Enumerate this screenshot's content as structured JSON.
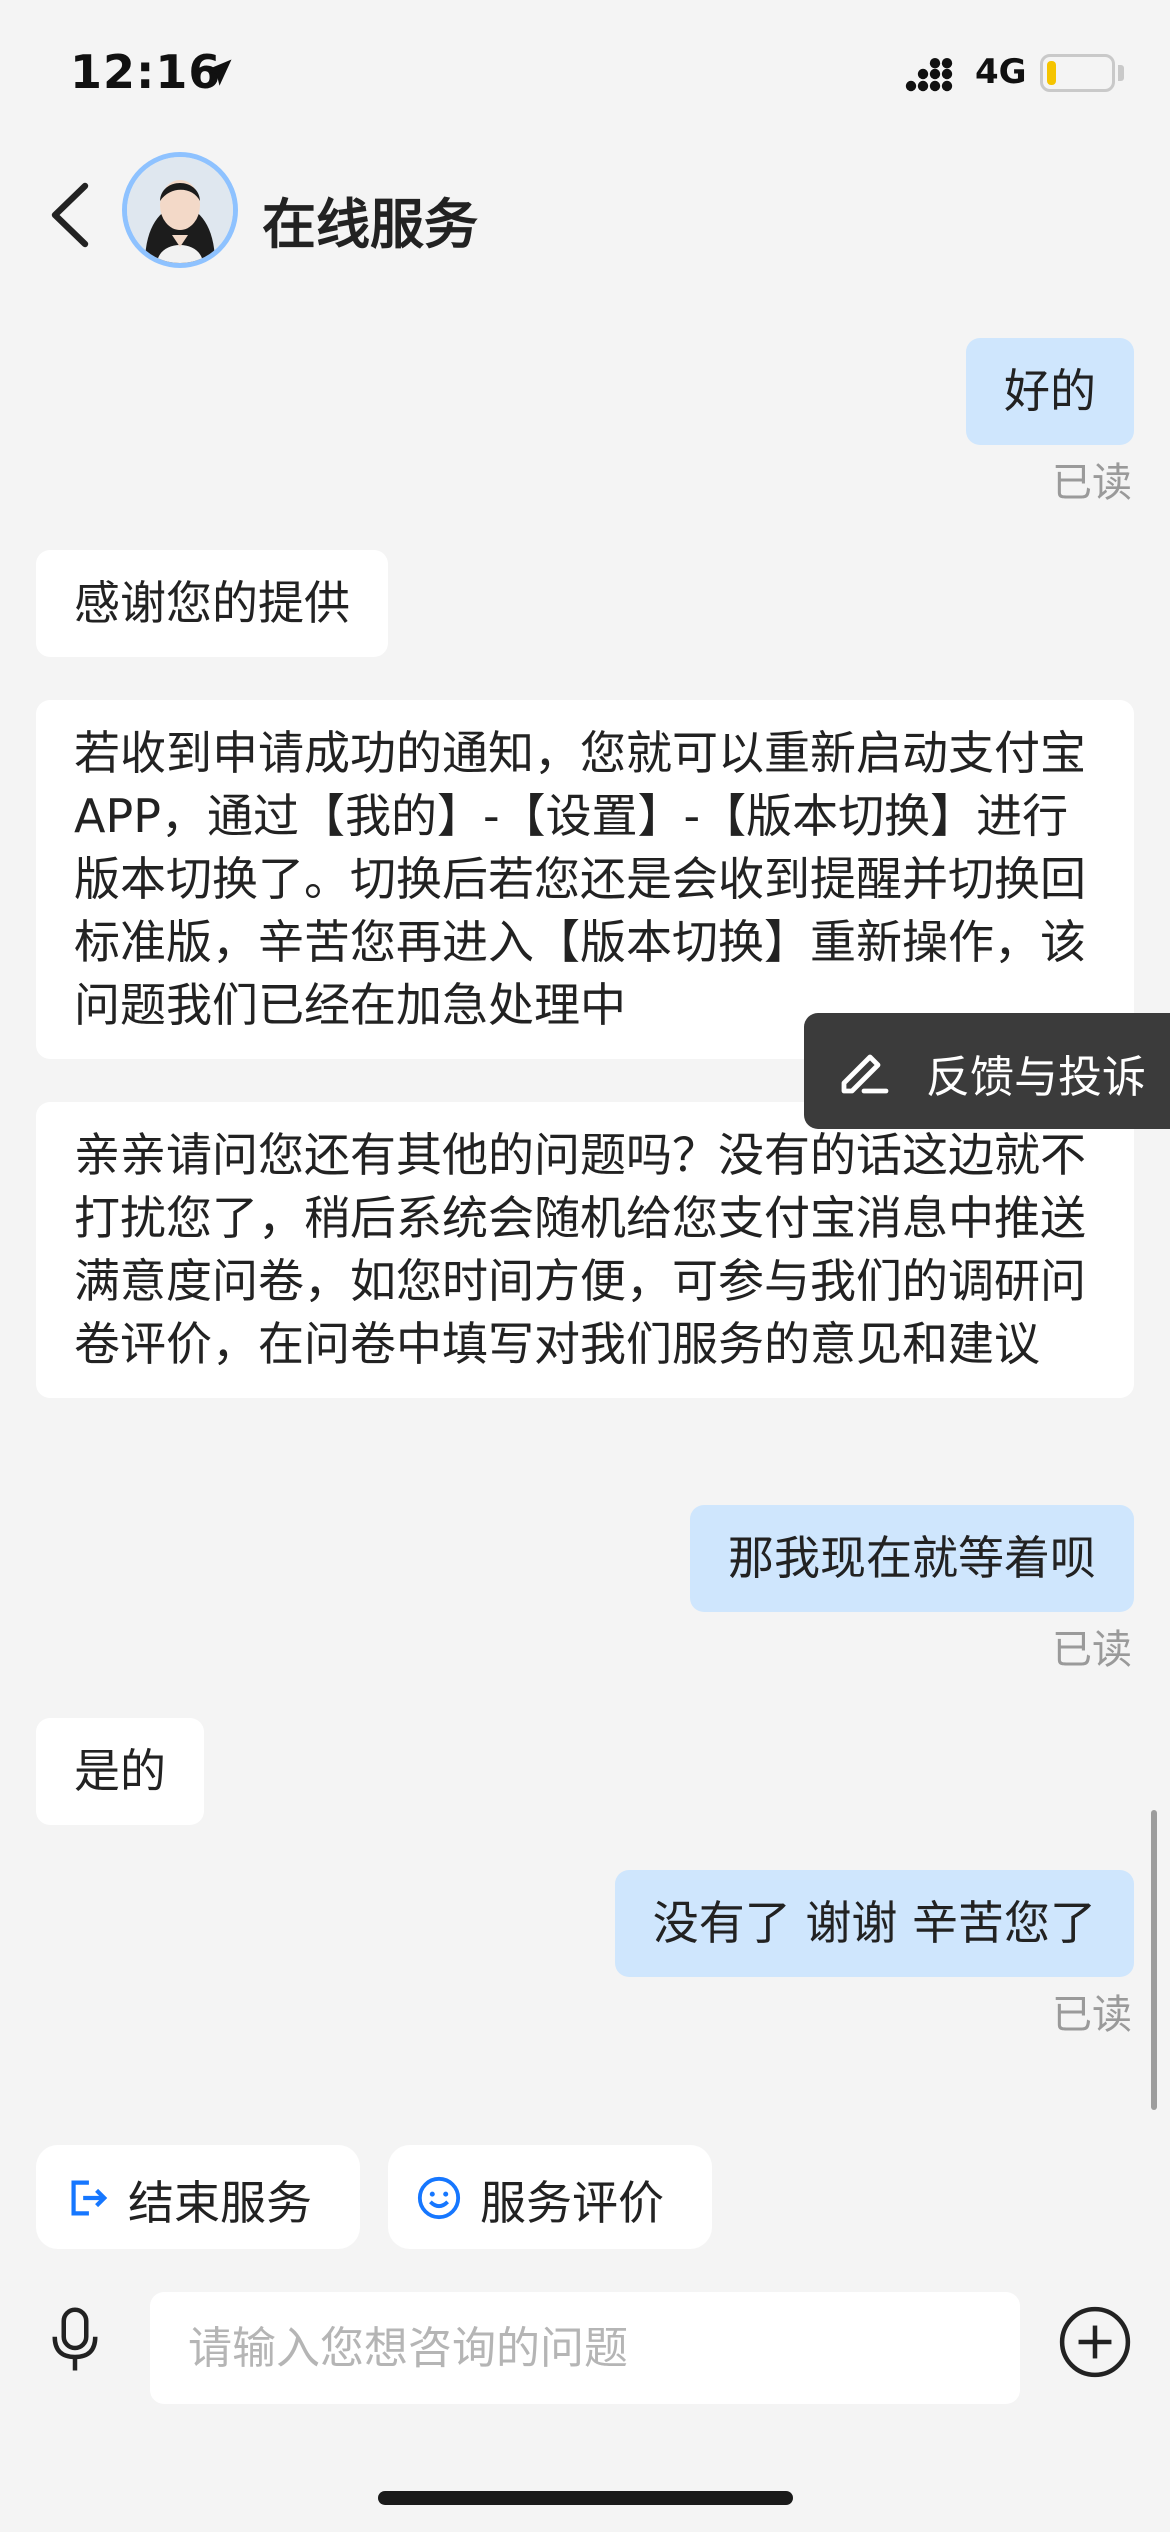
{
  "status_bar": {
    "time": "12:16",
    "network": "4G",
    "battery_level": 0.15,
    "battery_color": "#f5c400"
  },
  "header": {
    "title": "在线服务"
  },
  "messages": [
    {
      "from": "me",
      "text": "好的",
      "read": "已读"
    },
    {
      "from": "bot",
      "text": "感谢您的提供"
    },
    {
      "from": "bot",
      "text": "若收到申请成功的通知，您就可以重新启动支付宝APP，通过【我的】-【设置】-【版本切换】进行版本切换了。切换后若您还是会收到提醒并切换回标准版，辛苦您再进入【版本切换】重新操作，该问题我们已经在加急处理中"
    },
    {
      "from": "bot",
      "text": "亲亲请问您还有其他的问题吗？没有的话这边就不打扰您了，稍后系统会随机给您支付宝消息中推送满意度问卷，如您时间方便，可参与我们的调研问卷评价，在问卷中填写对我们服务的意见和建议"
    },
    {
      "from": "me",
      "text": "那我现在就等着呗",
      "read": "已读"
    },
    {
      "from": "bot",
      "text": "是的"
    },
    {
      "from": "me",
      "text": "没有了 谢谢 辛苦您了",
      "read": "已读"
    }
  ],
  "feedback": {
    "label": "反馈与投诉",
    "icon": "edit-icon"
  },
  "quick_actions": [
    {
      "label": "结束服务",
      "icon": "exit-icon"
    },
    {
      "label": "服务评价",
      "icon": "smile-icon"
    }
  ],
  "input": {
    "placeholder": "请输入您想咨询的问题",
    "value": ""
  },
  "colors": {
    "accent": "#1677ff",
    "my_bubble": "#cfe6fd",
    "bot_bubble": "#ffffff",
    "background": "#f4f4f4"
  }
}
